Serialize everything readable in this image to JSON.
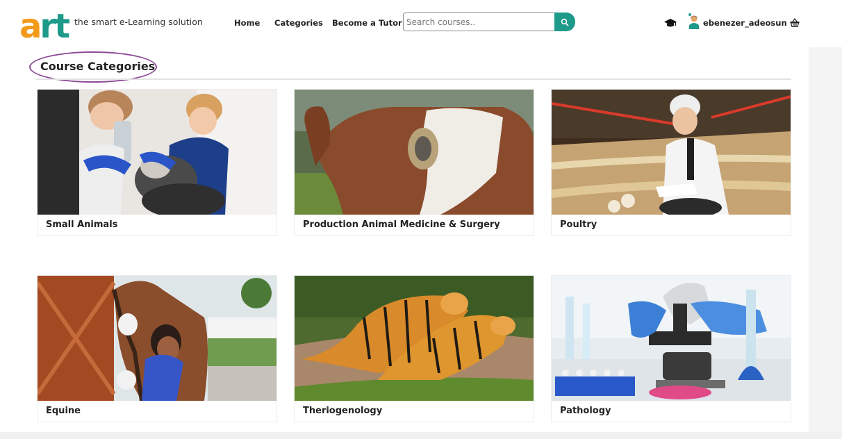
{
  "brand": {
    "logo_a": "a",
    "logo_rt": "rt",
    "tagline": "the smart e-Learning solution",
    "colors": {
      "orange": "#f39a1a",
      "teal": "#1e9a8a"
    }
  },
  "nav": {
    "home": "Home",
    "categories": "Categories",
    "become_tutor": "Become a Tutor"
  },
  "search": {
    "placeholder": "Search courses..",
    "icon": "search-icon"
  },
  "user": {
    "name": "ebenezer_adeosun",
    "icons": [
      "graduation-cap-icon",
      "avatar",
      "basket-icon"
    ]
  },
  "page": {
    "title": "Course Categories",
    "highlight_color": "#8c4a96"
  },
  "categories": [
    {
      "label": "Small Animals"
    },
    {
      "label": "Production Animal Medicine & Surgery"
    },
    {
      "label": "Poultry"
    },
    {
      "label": "Equine"
    },
    {
      "label": "Theriogenology"
    },
    {
      "label": "Pathology"
    }
  ]
}
